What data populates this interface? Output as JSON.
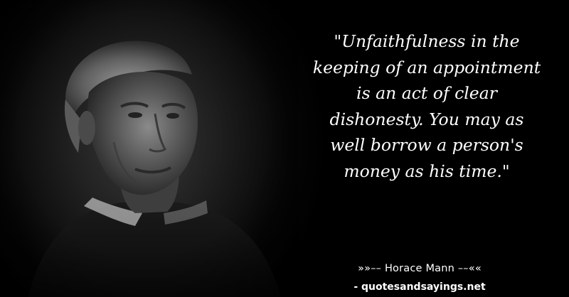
{
  "quote": {
    "line1": "\"Unfaithfulness in the",
    "line2": "keeping of an appointment",
    "line3": "is an act of clear",
    "line4": "dishonesty. You may as",
    "line5": "well borrow a person's",
    "line6": "money as his time.\""
  },
  "author": "»»–– Horace Mann ––««",
  "source": "- quotesandsayings.net"
}
